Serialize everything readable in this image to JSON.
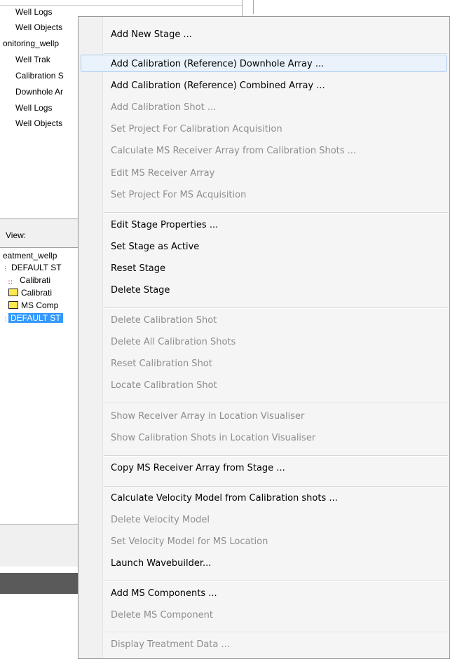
{
  "left_tree_top": [
    "Well Logs",
    "Well Objects",
    "onitoring_wellp",
    "Well Trak",
    "Calibration S",
    "Downhole Ar",
    "Well Logs",
    "Well Objects"
  ],
  "view_label": "View:",
  "left_tree_bottom": {
    "items": [
      "eatment_wellp",
      "DEFAULT ST",
      "Calibrati",
      "Calibrati",
      "MS Comp",
      "DEFAULT ST"
    ]
  },
  "menu": {
    "items": [
      {
        "label": "Add New Stage ...",
        "enabled": true
      },
      {
        "label": "Add Calibration (Reference) Downhole Array ...",
        "enabled": true
      },
      {
        "label": "Add Calibration (Reference) Combined Array ...",
        "enabled": true
      },
      {
        "label": "Add Calibration Shot ...",
        "enabled": false
      },
      {
        "label": "Set Project For Calibration Acquisition",
        "enabled": false
      },
      {
        "label": "Calculate MS Receiver Array from Calibration Shots ...",
        "enabled": false
      },
      {
        "label": "Edit MS Receiver Array",
        "enabled": false
      },
      {
        "label": "Set Project For MS Acquisition",
        "enabled": false
      },
      {
        "label": "Edit Stage Properties ...",
        "enabled": true
      },
      {
        "label": "Set Stage as Active",
        "enabled": true
      },
      {
        "label": "Reset Stage",
        "enabled": true
      },
      {
        "label": "Delete Stage",
        "enabled": true
      },
      {
        "label": "Delete Calibration Shot",
        "enabled": false
      },
      {
        "label": "Delete All Calibration Shots",
        "enabled": false
      },
      {
        "label": "Reset Calibration Shot",
        "enabled": false
      },
      {
        "label": "Locate Calibration Shot",
        "enabled": false
      },
      {
        "label": "Show Receiver Array in Location Visualiser",
        "enabled": false
      },
      {
        "label": "Show Calibration Shots in Location Visualiser",
        "enabled": false
      },
      {
        "label": "Copy MS Receiver Array from Stage ...",
        "enabled": true
      },
      {
        "label": "Calculate Velocity Model from Calibration shots ...",
        "enabled": true
      },
      {
        "label": "Delete Velocity Model",
        "enabled": false
      },
      {
        "label": "Set Velocity Model for MS Location",
        "enabled": false
      },
      {
        "label": "Launch Wavebuilder...",
        "enabled": true
      },
      {
        "label": "Add MS Components ...",
        "enabled": true
      },
      {
        "label": "Delete MS Component",
        "enabled": false
      },
      {
        "label": "Display Treatment Data ...",
        "enabled": false
      }
    ],
    "hovered_index": 1
  },
  "colors": {
    "selection": "#3399ff",
    "disabled_text": "#8d8d8d",
    "hover_fill": "#eaf2fb",
    "hover_border": "#a8cbef"
  }
}
